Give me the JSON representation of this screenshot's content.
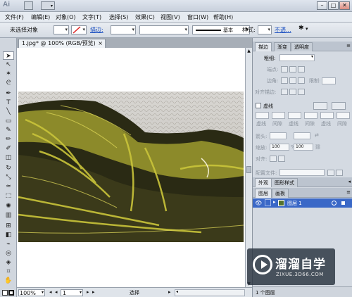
{
  "app": {
    "logo": "Ai"
  },
  "menus": [
    "文件(F)",
    "编辑(E)",
    "对象(O)",
    "文字(T)",
    "选择(S)",
    "效果(C)",
    "视图(V)",
    "窗口(W)",
    "帮助(H)"
  ],
  "window_controls": {
    "minimize": "–",
    "maximize": "□",
    "close": "✕"
  },
  "control_bar": {
    "selection_label": "未选择对象",
    "stroke_label": "描边:",
    "brush_label": "基本",
    "style_label": "样式:",
    "opacity_label": "不透..."
  },
  "document": {
    "tab_title": "1.jpg* @ 100% (RGB/预览)",
    "close_glyph": "×"
  },
  "status_bar": {
    "zoom": "100%",
    "artboard": "1",
    "tool": "选择"
  },
  "stroke_panel": {
    "tabs": [
      "描边",
      "渐变",
      "透明度"
    ],
    "weight_label": "粗细:",
    "cap_label": "端点:",
    "corner_label": "边角:",
    "limit_label": "限制:",
    "align_label": "对齐描边:",
    "dashed_label": "虚线",
    "dash_cells": [
      "虚线",
      "间隙",
      "虚线",
      "间隙",
      "虚线",
      "间隙"
    ],
    "arrow_label": "箭头:",
    "scale_label": "缩放:",
    "scale_values": [
      "100",
      "100"
    ],
    "align_arrow_label": "对齐:",
    "profile_label": "配置文件:"
  },
  "mid_tabs": [
    "外观",
    "图形样式"
  ],
  "layers_panel": {
    "tabs": [
      "图层",
      "画板"
    ],
    "layers": [
      {
        "name": "图层 1"
      }
    ],
    "footer": "1 个图层"
  },
  "watermark": {
    "title": "溜溜自学",
    "url": "ZIXUE.3D66.COM"
  },
  "colors": {
    "selection_blue": "#3a68c7",
    "link_blue": "#1a4fc1"
  },
  "tools": [
    "selection-tool",
    "direct-selection-tool",
    "magic-wand-tool",
    "lasso-tool",
    "pen-tool",
    "type-tool",
    "line-tool",
    "rectangle-tool",
    "paintbrush-tool",
    "pencil-tool",
    "blob-brush-tool",
    "eraser-tool",
    "rotate-tool",
    "scale-tool",
    "warp-tool",
    "free-transform-tool",
    "symbol-sprayer-tool",
    "graph-tool",
    "mesh-tool",
    "gradient-tool",
    "eyedropper-tool",
    "blend-tool",
    "live-paint-tool",
    "slice-tool",
    "hand-tool",
    "zoom-tool"
  ]
}
